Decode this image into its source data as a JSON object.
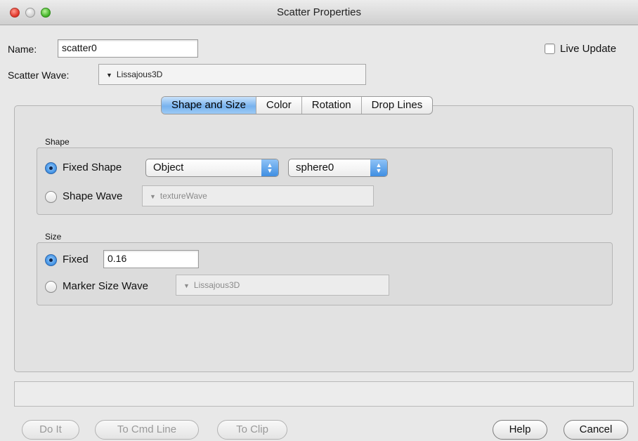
{
  "window": {
    "title": "Scatter Properties"
  },
  "name_row": {
    "label": "Name:",
    "value": "scatter0"
  },
  "live_update": {
    "label": "Live Update",
    "checked": false
  },
  "scatter_wave": {
    "label": "Scatter Wave:",
    "value": "Lissajous3D",
    "arrow": "▼"
  },
  "tabs": [
    {
      "label": "Shape and Size",
      "active": true
    },
    {
      "label": "Color",
      "active": false
    },
    {
      "label": "Rotation",
      "active": false
    },
    {
      "label": "Drop Lines",
      "active": false
    }
  ],
  "shape_group": {
    "title": "Shape",
    "fixed_shape": {
      "label": "Fixed Shape",
      "selected": true
    },
    "shape_type_popup": {
      "value": "Object"
    },
    "object_popup": {
      "value": "sphere0"
    },
    "shape_wave": {
      "label": "Shape Wave",
      "selected": false,
      "value": "textureWave",
      "arrow": "▼"
    }
  },
  "size_group": {
    "title": "Size",
    "fixed": {
      "label": "Fixed",
      "selected": true,
      "value": "0.16"
    },
    "marker_size_wave": {
      "label": "Marker Size Wave",
      "selected": false,
      "value": "Lissajous3D",
      "arrow": "▼"
    }
  },
  "buttons": {
    "do_it": "Do It",
    "to_cmd_line": "To Cmd Line",
    "to_clip": "To Clip",
    "help": "Help",
    "cancel": "Cancel"
  },
  "colors": {
    "tab_active": "#77b2ee",
    "radio_selected": "#3d8fe2",
    "close_button": "#e1362a",
    "zoom_button": "#44b52a"
  }
}
